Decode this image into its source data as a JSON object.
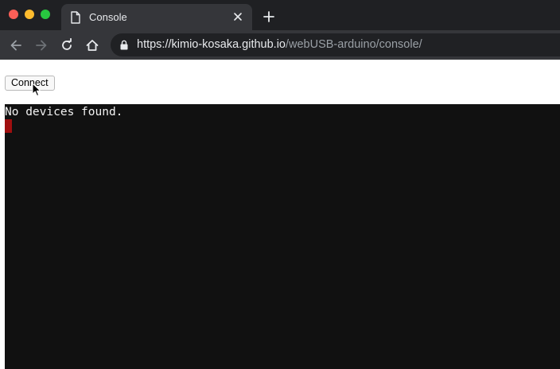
{
  "browser": {
    "tab_title": "Console",
    "url_host": "https://kimio-kosaka.github.io",
    "url_path": "/webUSB-arduino/console/"
  },
  "page": {
    "connect_label": "Connect",
    "terminal_output": "No devices found."
  },
  "colors": {
    "terminal_bg": "#111111",
    "cursor": "#a00f0f"
  },
  "icons": [
    "page-icon",
    "close-icon",
    "plus-icon",
    "back-arrow-icon",
    "forward-arrow-icon",
    "reload-icon",
    "home-icon",
    "lock-icon",
    "mouse-pointer-icon"
  ]
}
